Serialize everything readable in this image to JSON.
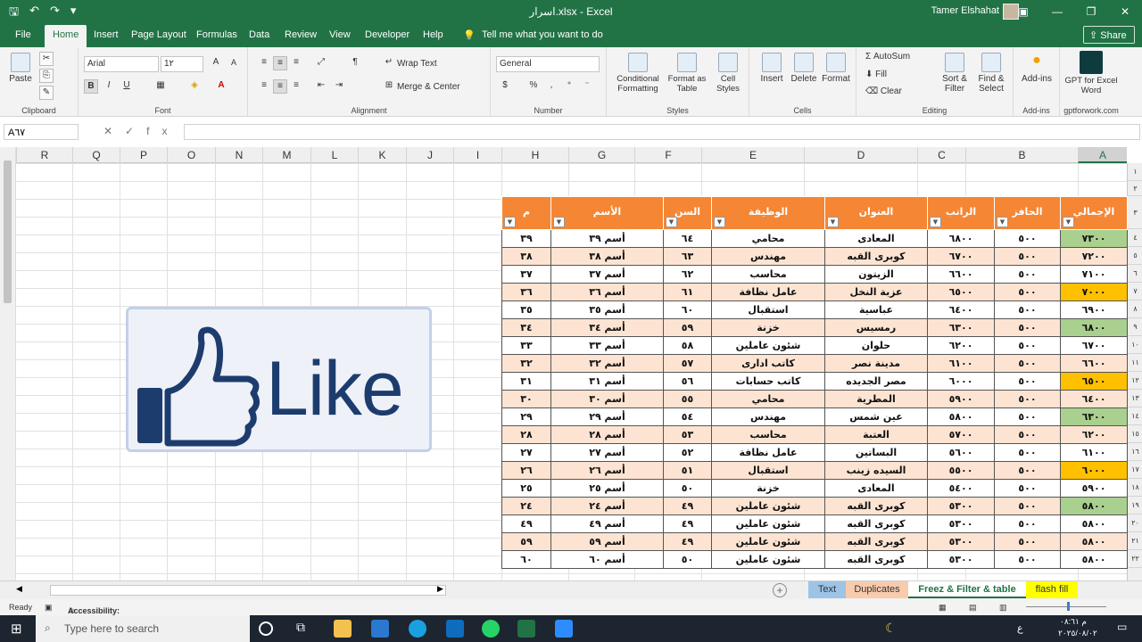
{
  "window": {
    "title": "اسرار.xlsx  -  Excel",
    "user": "Tamer Elshahat",
    "controls": [
      "▣",
      "—",
      "❐",
      "✕"
    ]
  },
  "qat": [
    "🖫",
    "↶",
    "↷",
    "▾"
  ],
  "tabs": [
    "File",
    "Home",
    "Insert",
    "Page Layout",
    "Formulas",
    "Data",
    "Review",
    "View",
    "Developer",
    "Help"
  ],
  "tell_me": "Tell me what you want to do",
  "share": "Share",
  "ribbon": {
    "clipboard": {
      "paste": "Paste",
      "label": "Clipboard"
    },
    "font": {
      "name": "Arial",
      "size": "1٢",
      "label": "Font",
      "bold": "B",
      "italic": "I",
      "underline": "U"
    },
    "alignment": {
      "wrap": "Wrap Text",
      "merge": "Merge & Center",
      "label": "Alignment"
    },
    "number": {
      "format": "General",
      "label": "Number",
      "percent": "%"
    },
    "styles": {
      "conditional": "Conditional Formatting",
      "format_table": "Format as Table",
      "cell_styles": "Cell Styles",
      "label": "Styles"
    },
    "cells": {
      "insert": "Insert",
      "delete": "Delete",
      "format": "Format",
      "label": "Cells"
    },
    "editing": {
      "autosum": "AutoSum",
      "fill": "Fill",
      "clear": "Clear",
      "sort": "Sort & Filter",
      "find": "Find & Select",
      "label": "Editing"
    },
    "addins": {
      "addins": "Add-ins",
      "label": "Add-ins"
    },
    "gpt": {
      "name": "GPT for Excel Word",
      "label": "gptforwork.com"
    }
  },
  "formula_bar": {
    "name_box": "A٦٧",
    "fx": "fx",
    "content": ""
  },
  "columns_left": [
    "R",
    "Q",
    "P",
    "O",
    "N",
    "M",
    "L",
    "K",
    "J",
    "I",
    "H",
    "G",
    "F",
    "E",
    "D",
    "C",
    "B",
    "A"
  ],
  "row_numbers": [
    "١",
    "٢",
    "٣",
    "٤",
    "٥",
    "٦",
    "٧",
    "٨",
    "٩",
    "١٠",
    "١١",
    "١٢",
    "١٣",
    "١٤",
    "١٥",
    "١٦",
    "١٧",
    "١٨",
    "١٩",
    "٢٠",
    "٢١",
    "٢٢"
  ],
  "table": {
    "headers": [
      "الإجمالي",
      "الحافز",
      "الراتب",
      "العنوان",
      "الوظيفة",
      "السن",
      "الأسم",
      "م"
    ],
    "rows": [
      [
        "٧٣٠٠",
        "٥٠٠",
        "٦٨٠٠",
        "المعادى",
        "محامي",
        "٦٤",
        "أسم ٣٩",
        "٣٩"
      ],
      [
        "٧٢٠٠",
        "٥٠٠",
        "٦٧٠٠",
        "كوبرى القبه",
        "مهندس",
        "٦٣",
        "أسم ٣٨",
        "٣٨"
      ],
      [
        "٧١٠٠",
        "٥٠٠",
        "٦٦٠٠",
        "الزيتون",
        "محاسب",
        "٦٢",
        "أسم ٣٧",
        "٣٧"
      ],
      [
        "٧٠٠٠",
        "٥٠٠",
        "٦٥٠٠",
        "عزبة النخل",
        "عامل نظافة",
        "٦١",
        "أسم ٣٦",
        "٣٦"
      ],
      [
        "٦٩٠٠",
        "٥٠٠",
        "٦٤٠٠",
        "عباسية",
        "استقبال",
        "٦٠",
        "أسم ٣٥",
        "٣٥"
      ],
      [
        "٦٨٠٠",
        "٥٠٠",
        "٦٣٠٠",
        "رمسيس",
        "خزنة",
        "٥٩",
        "أسم ٣٤",
        "٣٤"
      ],
      [
        "٦٧٠٠",
        "٥٠٠",
        "٦٢٠٠",
        "حلوان",
        "شئون عاملين",
        "٥٨",
        "أسم ٣٣",
        "٣٣"
      ],
      [
        "٦٦٠٠",
        "٥٠٠",
        "٦١٠٠",
        "مدينة نصر",
        "كاتب ادارى",
        "٥٧",
        "أسم ٣٢",
        "٣٢"
      ],
      [
        "٦٥٠٠",
        "٥٠٠",
        "٦٠٠٠",
        "مصر الجديده",
        "كاتب حسابات",
        "٥٦",
        "أسم ٣١",
        "٣١"
      ],
      [
        "٦٤٠٠",
        "٥٠٠",
        "٥٩٠٠",
        "المطرية",
        "محامي",
        "٥٥",
        "أسم ٣٠",
        "٣٠"
      ],
      [
        "٦٣٠٠",
        "٥٠٠",
        "٥٨٠٠",
        "عين شمس",
        "مهندس",
        "٥٤",
        "أسم ٢٩",
        "٢٩"
      ],
      [
        "٦٢٠٠",
        "٥٠٠",
        "٥٧٠٠",
        "العتبة",
        "محاسب",
        "٥٣",
        "أسم ٢٨",
        "٢٨"
      ],
      [
        "٦١٠٠",
        "٥٠٠",
        "٥٦٠٠",
        "البساتين",
        "عامل نظافة",
        "٥٢",
        "أسم ٢٧",
        "٢٧"
      ],
      [
        "٦٠٠٠",
        "٥٠٠",
        "٥٥٠٠",
        "السيده زينب",
        "استقبال",
        "٥١",
        "أسم ٢٦",
        "٢٦"
      ],
      [
        "٥٩٠٠",
        "٥٠٠",
        "٥٤٠٠",
        "المعادى",
        "خزنة",
        "٥٠",
        "أسم ٢٥",
        "٢٥"
      ],
      [
        "٥٨٠٠",
        "٥٠٠",
        "٥٣٠٠",
        "كوبرى القبه",
        "شئون عاملين",
        "٤٩",
        "أسم ٢٤",
        "٢٤"
      ],
      [
        "٥٨٠٠",
        "٥٠٠",
        "٥٣٠٠",
        "كوبرى القبه",
        "شئون عاملين",
        "٤٩",
        "أسم ٤٩",
        "٤٩"
      ],
      [
        "٥٨٠٠",
        "٥٠٠",
        "٥٣٠٠",
        "كوبرى القبه",
        "شئون عاملين",
        "٤٩",
        "أسم ٥٩",
        "٥٩"
      ],
      [
        "٥٨٠٠",
        "٥٠٠",
        "٥٣٠٠",
        "كوبرى القبه",
        "شئون عاملين",
        "٥٠",
        "أسم ٦٠",
        "٦٠"
      ]
    ],
    "highlight": [
      "green",
      "",
      "",
      "orange",
      "",
      "green",
      "",
      "",
      "orange",
      "",
      "green",
      "",
      "",
      "orange",
      "",
      "green",
      "",
      "",
      ""
    ]
  },
  "like_badge": {
    "text": "Like",
    "color": "#1d3c6e"
  },
  "sheet_tabs": [
    {
      "name": "Text",
      "bg": "#9dc3e6"
    },
    {
      "name": "Duplicates",
      "bg": "#f8cbad"
    },
    {
      "name": "Freez & Filter & table",
      "bg": "#ffffff",
      "active": true
    },
    {
      "name": "flash fill",
      "bg": "#ffff00"
    }
  ],
  "status": {
    "ready": "Ready",
    "accessibility": "Accessibility: Investigate"
  },
  "taskbar": {
    "search_placeholder": "Type here to search",
    "time": "م ٠٨:٦١",
    "date": "٢٠٢٥/٠٨/٠٢",
    "lang": "ع"
  },
  "colors": {
    "excel_green": "#217346",
    "header_orange": "#f58634",
    "row_alt": "#fde4d2",
    "green_cell": "#a9d08e",
    "orange_cell": "#ffc000"
  }
}
